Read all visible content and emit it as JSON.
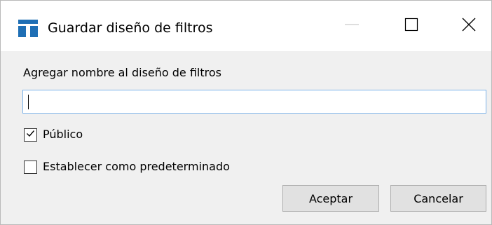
{
  "window": {
    "title": "Guardar diseño de filtros",
    "app_icon": "app-logo-icon",
    "controls": {
      "minimize_icon": "minimize-icon",
      "maximize_icon": "maximize-icon",
      "close_icon": "close-icon"
    }
  },
  "form": {
    "name_label": "Agregar nombre al diseño de filtros",
    "name_value": "",
    "name_placeholder": "",
    "public_label": "Público",
    "public_checked": true,
    "default_label": "Establecer como predeterminado",
    "default_checked": false
  },
  "buttons": {
    "accept_label": "Aceptar",
    "cancel_label": "Cancelar"
  },
  "colors": {
    "app_icon": "#1f6fb5",
    "input_focus_border": "#7eb4ea",
    "button_face": "#e1e1e1",
    "dialog_background": "#f0f0f0"
  }
}
